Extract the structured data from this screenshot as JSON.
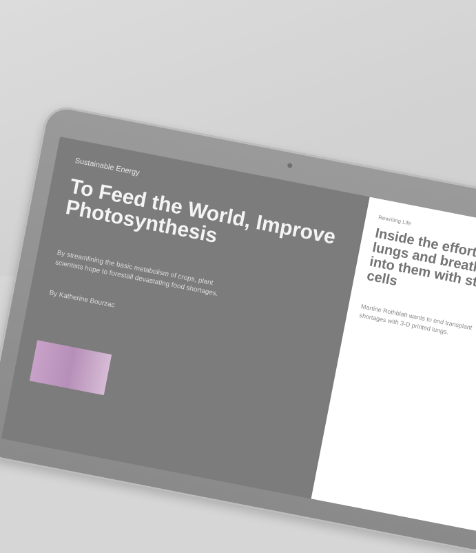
{
  "left_article": {
    "section": "Sustainable Energy",
    "title": "To Feed the World, Improve Photosynthesis",
    "dek": "By streamlining the basic metabolism of crops, plant scientists hope to forestall devastating food shortages.",
    "byline": "By Katherine Bourzac"
  },
  "right_article": {
    "section": "Rewriting Life",
    "title": "Inside the effort to print lungs and breathe life into them with stem cells",
    "dek": "Martine Rothblatt wants to end transplant shortages with 3-D printed lungs."
  }
}
